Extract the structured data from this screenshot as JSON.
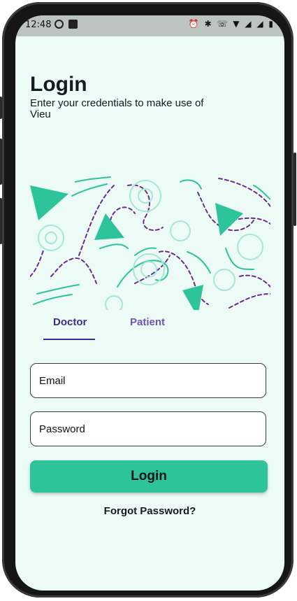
{
  "status_bar": {
    "time": "12:48",
    "right_icons": "⏰ ✱ ☏ ▼ ◢ ◢ ▮",
    "icons": [
      "whatsapp-icon",
      "notification-icon",
      "alarm-icon",
      "bluetooth-icon",
      "wifi-call-icon",
      "wifi-icon",
      "signal-icon",
      "battery-icon"
    ]
  },
  "header": {
    "title": "Login",
    "subtitle": "Enter your credentials to make use of Vieu"
  },
  "tabs": {
    "items": [
      {
        "label": "Doctor",
        "selected": true
      },
      {
        "label": "Patient",
        "selected": false
      }
    ]
  },
  "form": {
    "email_placeholder": "Email",
    "password_placeholder": "Password",
    "login_label": "Login",
    "forgot_label": "Forgot Password?"
  },
  "colors": {
    "background": "#ecfbf6",
    "accent": "#2dc49c",
    "tab_selected": "#3f2c8c",
    "tab_unselected": "#6f55b6",
    "dashed_lines": "#6a2c95"
  }
}
